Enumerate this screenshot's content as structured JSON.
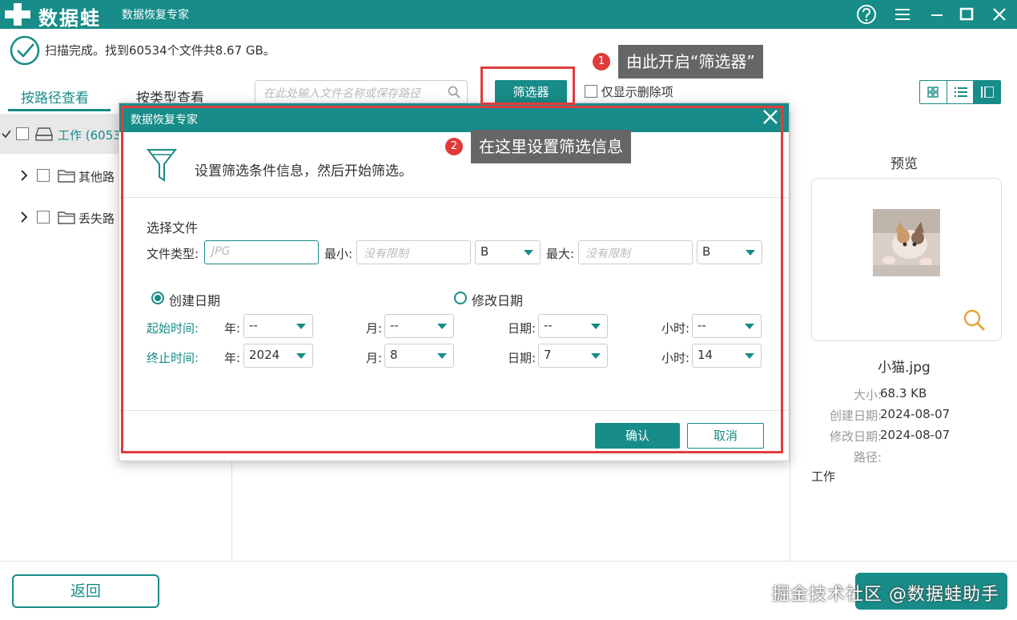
{
  "app": {
    "brand": "数据蛙",
    "title": "数据恢复专家"
  },
  "status": {
    "text": "扫描完成。找到60534个文件共8.67 GB。"
  },
  "tabs": {
    "by_path": "按路径查看",
    "by_type": "按类型查看"
  },
  "tree": [
    {
      "label": "工作 (6053"
    },
    {
      "label": "其他路"
    },
    {
      "label": "丢失路"
    }
  ],
  "toolbar": {
    "search_placeholder": "在此处输入文件名称或保存路径",
    "filter_label": "筛选器",
    "only_deleted_label": "仅显示删除项"
  },
  "preview": {
    "title": "预览",
    "file_name": "小猫.jpg",
    "size_label": "大小:",
    "size_value": "68.3 KB",
    "created_label": "创建日期:",
    "created_value": "2024-08-07",
    "modified_label": "修改日期:",
    "modified_value": "2024-08-07",
    "path_label": "路径:",
    "path_value": "工作"
  },
  "bottom": {
    "back_label": "返回"
  },
  "watermark": "掘金技术社区 @数据蛙助手",
  "callouts": {
    "c1_num": "1",
    "c1_text": "由此开启“筛选器”",
    "c2_num": "2",
    "c2_text": "在这里设置筛选信息"
  },
  "dialog": {
    "title": "数据恢复专家",
    "intro": "设置筛选条件信息，然后开始筛选。",
    "select_file": "选择文件",
    "file_type_label": "文件类型:",
    "file_type_placeholder": "JPG",
    "min_label": "最小:",
    "min_placeholder": "没有限制",
    "min_unit": "B",
    "max_label": "最大:",
    "max_placeholder": "没有限制",
    "max_unit": "B",
    "created_date": "创建日期",
    "modified_date": "修改日期",
    "start_label": "起始时间:",
    "end_label": "终止时间:",
    "year_label": "年:",
    "month_label": "月:",
    "day_label": "日期:",
    "hour_label": "小时:",
    "start": {
      "year": "--",
      "month": "--",
      "day": "--",
      "hour": "--"
    },
    "end": {
      "year": "2024",
      "month": "8",
      "day": "7",
      "hour": "14"
    },
    "ok": "确认",
    "cancel": "取消"
  },
  "colors": {
    "accent": "#178c88",
    "highlight": "#e23c3c",
    "callout_bg": "#666666"
  }
}
